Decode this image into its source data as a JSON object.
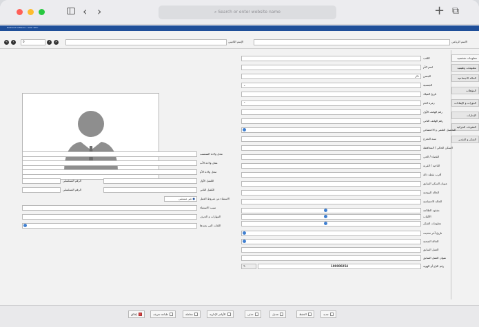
{
  "browser": {
    "url_placeholder": "Search or enter website name",
    "back_glyph": "‹",
    "forward_glyph": "›",
    "plus_glyph": "+",
    "tabs_glyph": "⧉"
  },
  "window_title": "Rasheed Software - Isdar Wrkr",
  "header": {
    "full_name_label": "الاسم الرباعي",
    "latin_name_label": "الإسم اللاتيني",
    "nav_value": "0"
  },
  "sidebar_tabs": [
    "معلومات شخصية",
    "معلومات وظيفية",
    "الحالة الاجتماعية",
    "المؤهلات",
    "الدورات و الإيفادات",
    "الإجازات",
    "العقوبات الجزائية",
    "الشكر و التقدير"
  ],
  "right_form": {
    "labels": [
      "اللقب",
      "اسم الأم",
      "الجنس",
      "الجنسية",
      "تاريخ الميلاد",
      "زمرة الدم",
      "رقم الهاتف الأول",
      "رقم الهاتف الثاني",
      "التحصيل العلمي و الاختصاص",
      "سنة التخرج",
      "السكن الحالي / المحافظة",
      "القضاء / الحي",
      "الناحية / القرية",
      "أقرب نقطة دالة",
      "عنوان السكن السابق",
      "الحالة الزوجية",
      "الحالة الاجتماعية",
      "مفقود الظلامة",
      "الألقاب",
      "معلومات الشكر"
    ],
    "gender_value": "ذكر"
  },
  "lower_right": {
    "labels": [
      "تاريخ آخر تحديث",
      "الحالة الصحية",
      "العمل السابق",
      "عنوان العمل السابق",
      "رقم الباج أو الهوية"
    ],
    "id_number": "100000254"
  },
  "left_form": {
    "labels": [
      "محل ولادة المنتسب",
      "محل ولادة الأب",
      "محل ولادة الأم",
      "الكفيل الأول",
      "الكفيل الثاني",
      "الاستثناء من شروط العمل",
      "سبب الاستثناء",
      "المهارات و الحرف",
      "اللغات التي يجيدها"
    ],
    "sponsor_serial_label": "الرقم التسلسلي",
    "exception_value": "غير مستثنى"
  },
  "footer_buttons": [
    {
      "label": "جديد"
    },
    {
      "label": "الحفظ"
    },
    {
      "label": "تعديل"
    },
    {
      "label": "حذف"
    },
    {
      "label": "الأوامر الإدارية"
    },
    {
      "label": "معاملة"
    },
    {
      "label": "طباعة تعريف"
    },
    {
      "label": "إغلاق"
    }
  ],
  "colors": {
    "accent_blue": "#1f4f99",
    "dot_blue": "#3f7fd0",
    "close_red": "#d64545",
    "traffic_red": "#ff5f57",
    "traffic_yellow": "#febc2e",
    "traffic_green": "#28c840"
  }
}
